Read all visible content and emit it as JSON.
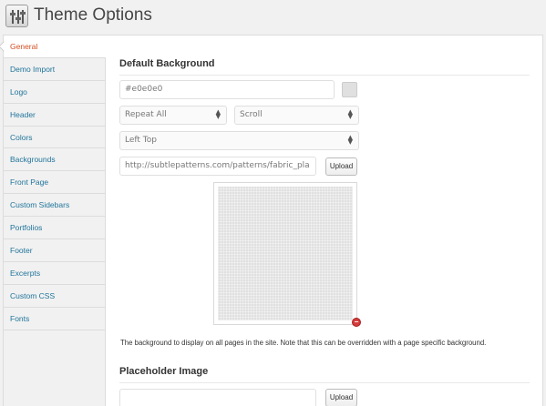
{
  "header": {
    "title": "Theme Options",
    "icon": "settings-icon"
  },
  "sidebar": {
    "items": [
      {
        "label": "General",
        "active": true
      },
      {
        "label": "Demo Import"
      },
      {
        "label": "Logo"
      },
      {
        "label": "Header"
      },
      {
        "label": "Colors"
      },
      {
        "label": "Backgrounds"
      },
      {
        "label": "Front Page"
      },
      {
        "label": "Custom Sidebars"
      },
      {
        "label": "Portfolios"
      },
      {
        "label": "Footer"
      },
      {
        "label": "Excerpts"
      },
      {
        "label": "Custom CSS"
      },
      {
        "label": "Fonts"
      }
    ]
  },
  "background": {
    "title": "Default Background",
    "color_value": "#e0e0e0",
    "swatch_color": "#e0e0e0",
    "repeat": "Repeat All",
    "attachment": "Scroll",
    "position": "Left Top",
    "image_url": "http://subtlepatterns.com/patterns/fabric_pla",
    "upload_label": "Upload",
    "description": "The background to display on all pages in the site. Note that this can be overridden with a page specific background."
  },
  "placeholder": {
    "title": "Placeholder Image",
    "image_url": "",
    "upload_label": "Upload"
  },
  "colors": {
    "link": "#21759b",
    "active": "#d54e21",
    "remove": "#d43c3c"
  }
}
